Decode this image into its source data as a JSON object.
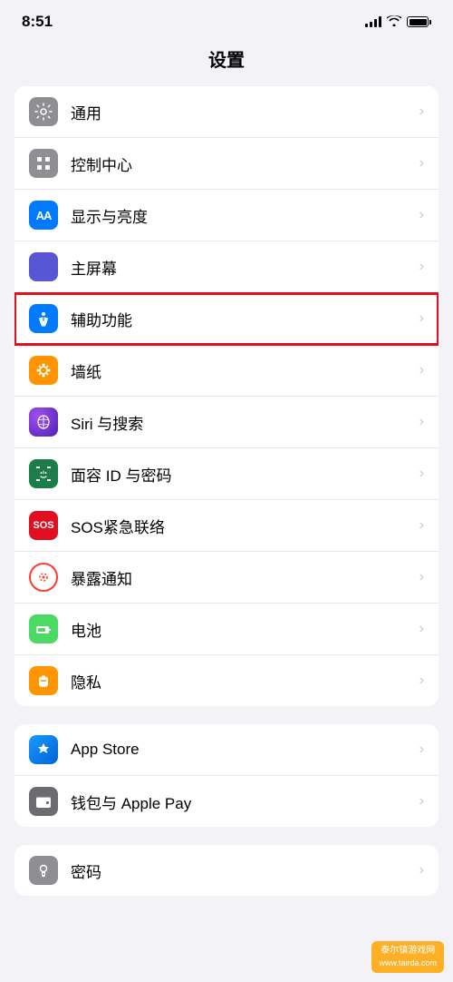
{
  "statusBar": {
    "time": "8:51"
  },
  "pageTitle": "设置",
  "section1": {
    "items": [
      {
        "id": "tongyong",
        "label": "通用",
        "iconClass": "icon-tongyong",
        "iconText": "⚙",
        "highlighted": false
      },
      {
        "id": "kongzhi",
        "label": "控制中心",
        "iconClass": "icon-kongzhi",
        "iconText": "⊙",
        "highlighted": false
      },
      {
        "id": "xianshi",
        "label": "显示与亮度",
        "iconClass": "icon-xianshi",
        "iconText": "AA",
        "highlighted": false
      },
      {
        "id": "zhupingmu",
        "label": "主屏幕",
        "iconClass": "icon-zhupingmu",
        "iconText": "⊞",
        "highlighted": false
      },
      {
        "id": "fuzhu",
        "label": "辅助功能",
        "iconClass": "icon-fuzhu",
        "iconText": "♿",
        "highlighted": true
      },
      {
        "id": "bizhi",
        "label": "墙纸",
        "iconClass": "icon-bizhi",
        "iconText": "✿",
        "highlighted": false
      },
      {
        "id": "siri",
        "label": "Siri 与搜索",
        "iconClass": "icon-siri",
        "iconText": "◎",
        "highlighted": false
      },
      {
        "id": "mianrong",
        "label": "面容 ID 与密码",
        "iconClass": "icon-mianrong",
        "iconText": "☺",
        "highlighted": false
      },
      {
        "id": "sos",
        "label": "SOS紧急联络",
        "iconClass": "icon-sos",
        "iconText": "SOS",
        "highlighted": false
      },
      {
        "id": "baolu",
        "label": "暴露通知",
        "iconClass": "icon-baolu",
        "iconText": "✳",
        "highlighted": false
      },
      {
        "id": "diandian",
        "label": "电池",
        "iconClass": "icon-diandian",
        "iconText": "▬",
        "highlighted": false
      },
      {
        "id": "yinsi",
        "label": "隐私",
        "iconClass": "icon-yinsi",
        "iconText": "✋",
        "highlighted": false
      }
    ]
  },
  "section2": {
    "items": [
      {
        "id": "appstore",
        "label": "App Store",
        "iconClass": "icon-appstore",
        "iconText": "A",
        "highlighted": false
      },
      {
        "id": "qianbao",
        "label": "钱包与 Apple Pay",
        "iconClass": "icon-qianbao",
        "iconText": "▣",
        "highlighted": false
      }
    ]
  },
  "section3": {
    "items": [
      {
        "id": "mima",
        "label": "密码",
        "iconClass": "icon-mima",
        "iconText": "🔑",
        "highlighted": false
      }
    ]
  },
  "watermark": {
    "line1": "泰尔镇游戏网",
    "line2": "www.tairda.com"
  },
  "chevron": "›"
}
